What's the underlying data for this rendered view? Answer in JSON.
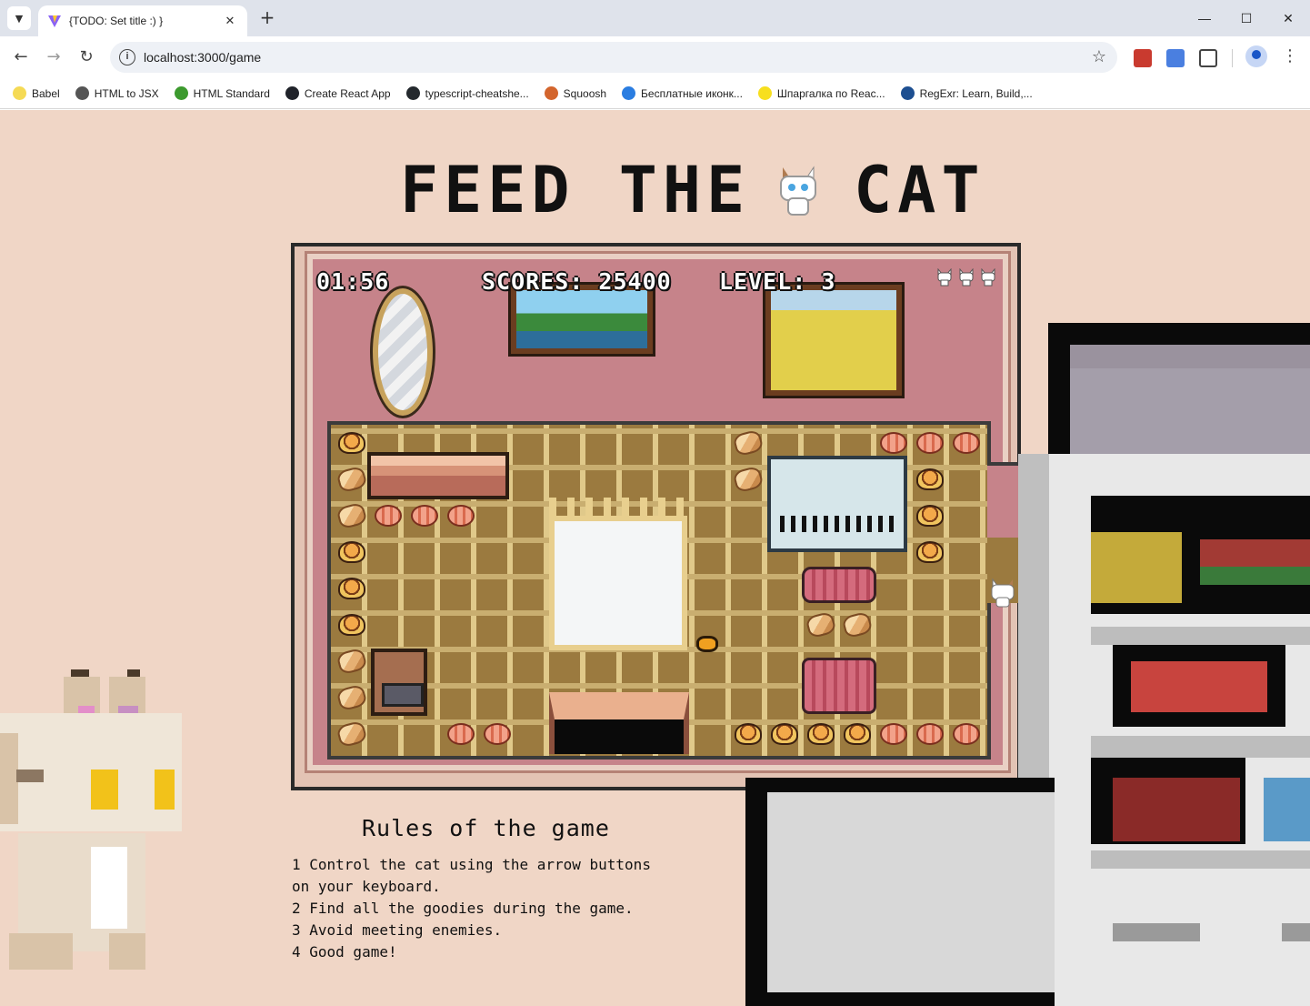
{
  "browser": {
    "tab_title": "{TODO: Set title :) }",
    "url": "localhost:3000/game",
    "bookmarks": [
      {
        "label": "Babel",
        "icon": "babel-icon",
        "color": "#f5da55"
      },
      {
        "label": "HTML to JSX",
        "icon": "globe-icon",
        "color": "#555555"
      },
      {
        "label": "HTML Standard",
        "icon": "html-standard-icon",
        "color": "#3c9a2e"
      },
      {
        "label": "Create React App",
        "icon": "react-icon",
        "color": "#20232a"
      },
      {
        "label": "typescript-cheatshe...",
        "icon": "github-icon",
        "color": "#24292e"
      },
      {
        "label": "Squoosh",
        "icon": "squoosh-icon",
        "color": "#d3652d"
      },
      {
        "label": "Бесплатные иконк...",
        "icon": "icons-site-icon",
        "color": "#2a7de1"
      },
      {
        "label": "Шпаргалка по Reac...",
        "icon": "js-icon",
        "color": "#f7df1e"
      },
      {
        "label": "RegExr: Learn, Build,...",
        "icon": "regexr-icon",
        "color": "#1d4f91"
      }
    ]
  },
  "game": {
    "title_left": "FEED THE",
    "title_right": "CAT",
    "timer": "01:56",
    "scores": "SCORES: 25400",
    "level": "LEVEL: 3",
    "lives": 3,
    "colors": {
      "page_bg": "#f0d6c6",
      "wall": "#c6838a",
      "floor": "#9b7a3f",
      "hud_text": "#ffffff"
    }
  },
  "rules": {
    "title": "Rules of the game",
    "text": "1 Control the cat using the arrow buttons\non your keyboard.\n2 Find all the goodies during the game.\n3 Avoid meeting enemies.\n4 Good game!"
  }
}
